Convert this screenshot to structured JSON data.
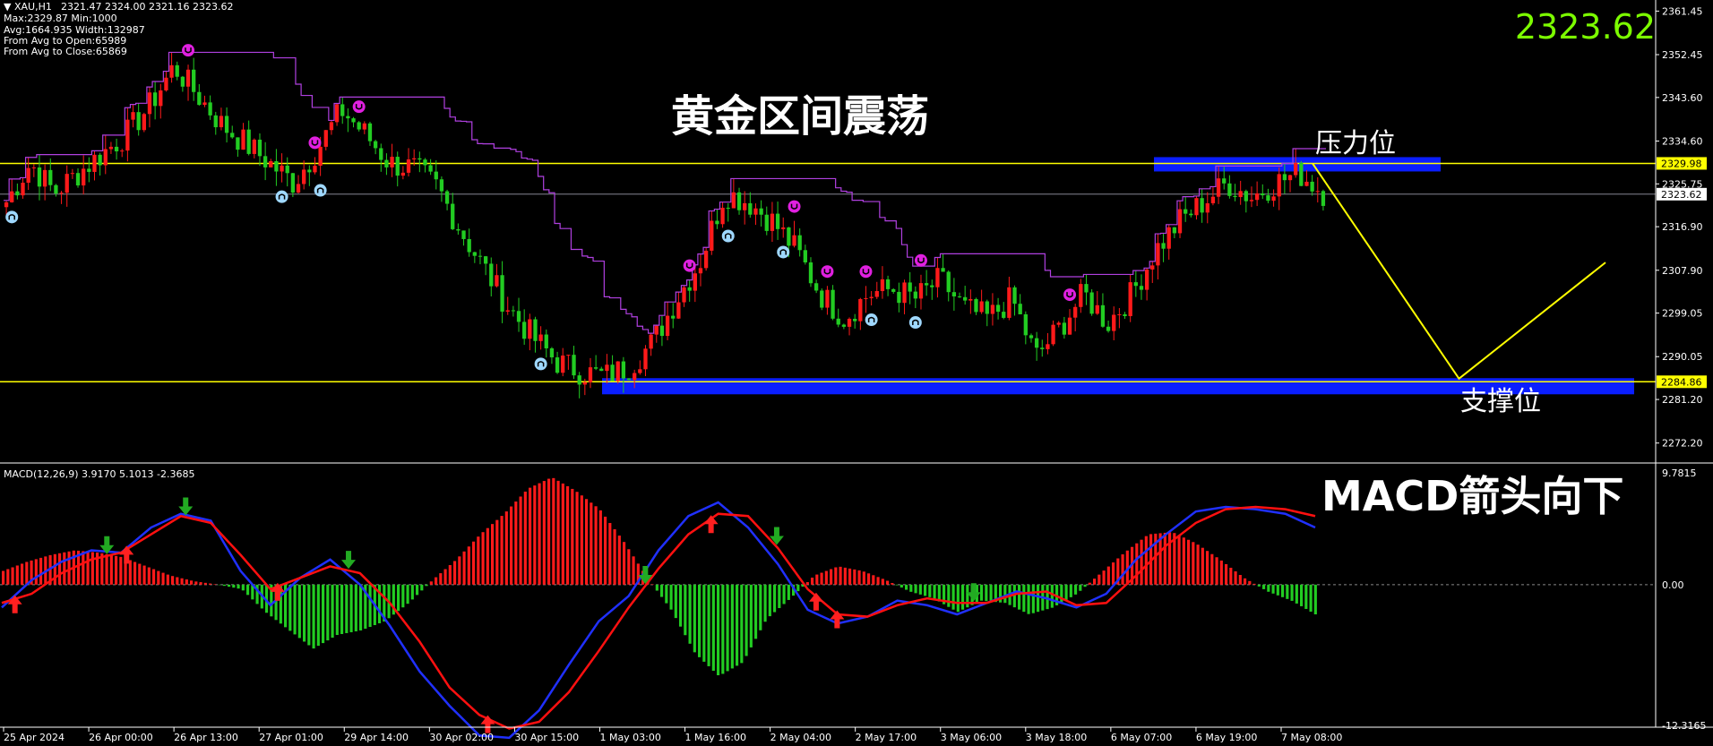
{
  "header": {
    "symbol": "XAU,H1",
    "ohlc": "2321.47 2324.00 2321.16 2323.62",
    "stats": [
      "Max:2329.87 Min:1000",
      "Avg:1664.935 Width:132987",
      "From Avg to Open:65989",
      "From Avg to Close:65869"
    ],
    "current_price": "2323.62"
  },
  "annotations": {
    "title": "黄金区间震荡",
    "resistance": "压力位",
    "support": "支撑位",
    "macd_note": "MACD箭头向下"
  },
  "macd": {
    "label": "MACD(12,26,9) 3.9170 5.1013 -2.3685"
  },
  "colors": {
    "bull": "#ff1a1a",
    "bear": "#22cc22",
    "level_line": "#ffff00",
    "zone": "#0a1eff",
    "donchian": "#b040e0",
    "macd_line": "#2030ff",
    "signal_line": "#ff1010",
    "price_text": "#7cfc00",
    "magenta_marker": "#e020e0",
    "cyan_marker": "#9fd8ff"
  },
  "chart_data": [
    {
      "type": "candlestick",
      "title": "",
      "price_axis_ticks": [
        "2361.45",
        "2352.45",
        "2343.60",
        "2334.60",
        "2325.75",
        "2316.90",
        "2307.90",
        "2299.05",
        "2290.05",
        "2281.20",
        "2272.20"
      ],
      "price_tick_values": [
        2361.45,
        2352.45,
        2343.6,
        2334.6,
        2325.75,
        2316.9,
        2307.9,
        2299.05,
        2290.05,
        2281.2,
        2272.2
      ],
      "time_labels": [
        "25 Apr 2024",
        "26 Apr 00:00",
        "26 Apr 13:00",
        "27 Apr 01:00",
        "29 Apr 14:00",
        "30 Apr 02:00",
        "30 Apr 15:00",
        "1 May 03:00",
        "1 May 16:00",
        "2 May 04:00",
        "2 May 17:00",
        "3 May 06:00",
        "3 May 18:00",
        "6 May 07:00",
        "6 May 19:00",
        "7 May 08:00"
      ],
      "resistance_level": 2329.98,
      "resistance_label": "2329.98",
      "support_level": 2284.86,
      "support_label": "2284.86",
      "last_price": 2323.62,
      "last_price_label": "2323.62",
      "close_path": [
        2322,
        2330,
        2324,
        2328,
        2332,
        2336,
        2342,
        2350,
        2344,
        2338,
        2334,
        2330,
        2326,
        2333,
        2341,
        2336,
        2330,
        2329,
        2325,
        2316,
        2308,
        2300,
        2294,
        2289,
        2287,
        2286,
        2288,
        2293,
        2302,
        2310,
        2324,
        2322,
        2318,
        2312,
        2303,
        2298,
        2303,
        2304,
        2302,
        2306,
        2300,
        2298,
        2302,
        2290,
        2296,
        2303,
        2297,
        2303,
        2312,
        2318,
        2322,
        2326,
        2323,
        2326,
        2328,
        2324
      ],
      "projection": [
        {
          "t": 0,
          "price": 2329.98
        },
        {
          "t": 0.5,
          "price": 2285.5
        },
        {
          "t": 1,
          "price": 2309.5
        }
      ]
    },
    {
      "type": "bar",
      "title": "",
      "axis_ticks": [
        "9.7815",
        "0.00",
        "-12.3165"
      ],
      "axis_tick_values": [
        9.7815,
        0,
        -12.3165
      ],
      "histogram": [
        1.2,
        2.0,
        2.6,
        3.0,
        2.8,
        2.4,
        1.6,
        0.8,
        0.3,
        0.0,
        -0.4,
        -2.4,
        -4.0,
        -5.6,
        -4.4,
        -4.0,
        -3.2,
        -1.6,
        0.4,
        2.2,
        4.4,
        6.2,
        8.4,
        9.4,
        8.2,
        6.6,
        3.8,
        0.6,
        -2.2,
        -6.0,
        -8.0,
        -6.8,
        -3.0,
        -1.2,
        0.8,
        1.6,
        1.2,
        0.4,
        -0.6,
        -1.2,
        -2.4,
        -1.4,
        -1.6,
        -2.6,
        -2.0,
        -0.8,
        1.0,
        2.8,
        4.4,
        4.6,
        3.6,
        2.2,
        0.6,
        -0.6,
        -1.4,
        -2.6
      ],
      "macd_line": [
        -2.0,
        0.4,
        2.0,
        3.0,
        2.8,
        5.0,
        6.2,
        5.6,
        1.2,
        -1.8,
        0.6,
        2.2,
        0.0,
        -3.6,
        -7.6,
        -10.6,
        -13.2,
        -13.4,
        -11.0,
        -7.0,
        -3.2,
        -1.0,
        3.0,
        6.0,
        7.2,
        5.0,
        1.8,
        -2.2,
        -3.4,
        -2.8,
        -1.4,
        -1.8,
        -2.6,
        -1.6,
        -0.6,
        -1.2,
        -2.0,
        -0.8,
        2.2,
        4.4,
        6.4,
        6.8,
        6.6,
        6.2,
        5.0
      ],
      "signal_line": [
        -1.6,
        -0.8,
        1.0,
        2.2,
        2.8,
        4.4,
        6.0,
        5.4,
        2.6,
        -0.4,
        0.6,
        1.6,
        1.0,
        -1.6,
        -5.0,
        -9.0,
        -11.4,
        -12.6,
        -12.0,
        -9.4,
        -5.8,
        -2.0,
        1.4,
        4.4,
        6.2,
        6.0,
        3.2,
        -0.4,
        -2.6,
        -2.8,
        -1.8,
        -1.2,
        -1.6,
        -1.6,
        -0.8,
        -0.6,
        -1.8,
        -1.6,
        0.8,
        3.4,
        5.4,
        6.6,
        6.8,
        6.6,
        6.0
      ],
      "up_arrows": [
        0.01,
        0.095,
        0.21,
        0.37,
        0.54,
        0.636,
        0.62
      ],
      "down_arrows": [
        0.08,
        0.14,
        0.264,
        0.49,
        0.59,
        0.74
      ]
    }
  ]
}
